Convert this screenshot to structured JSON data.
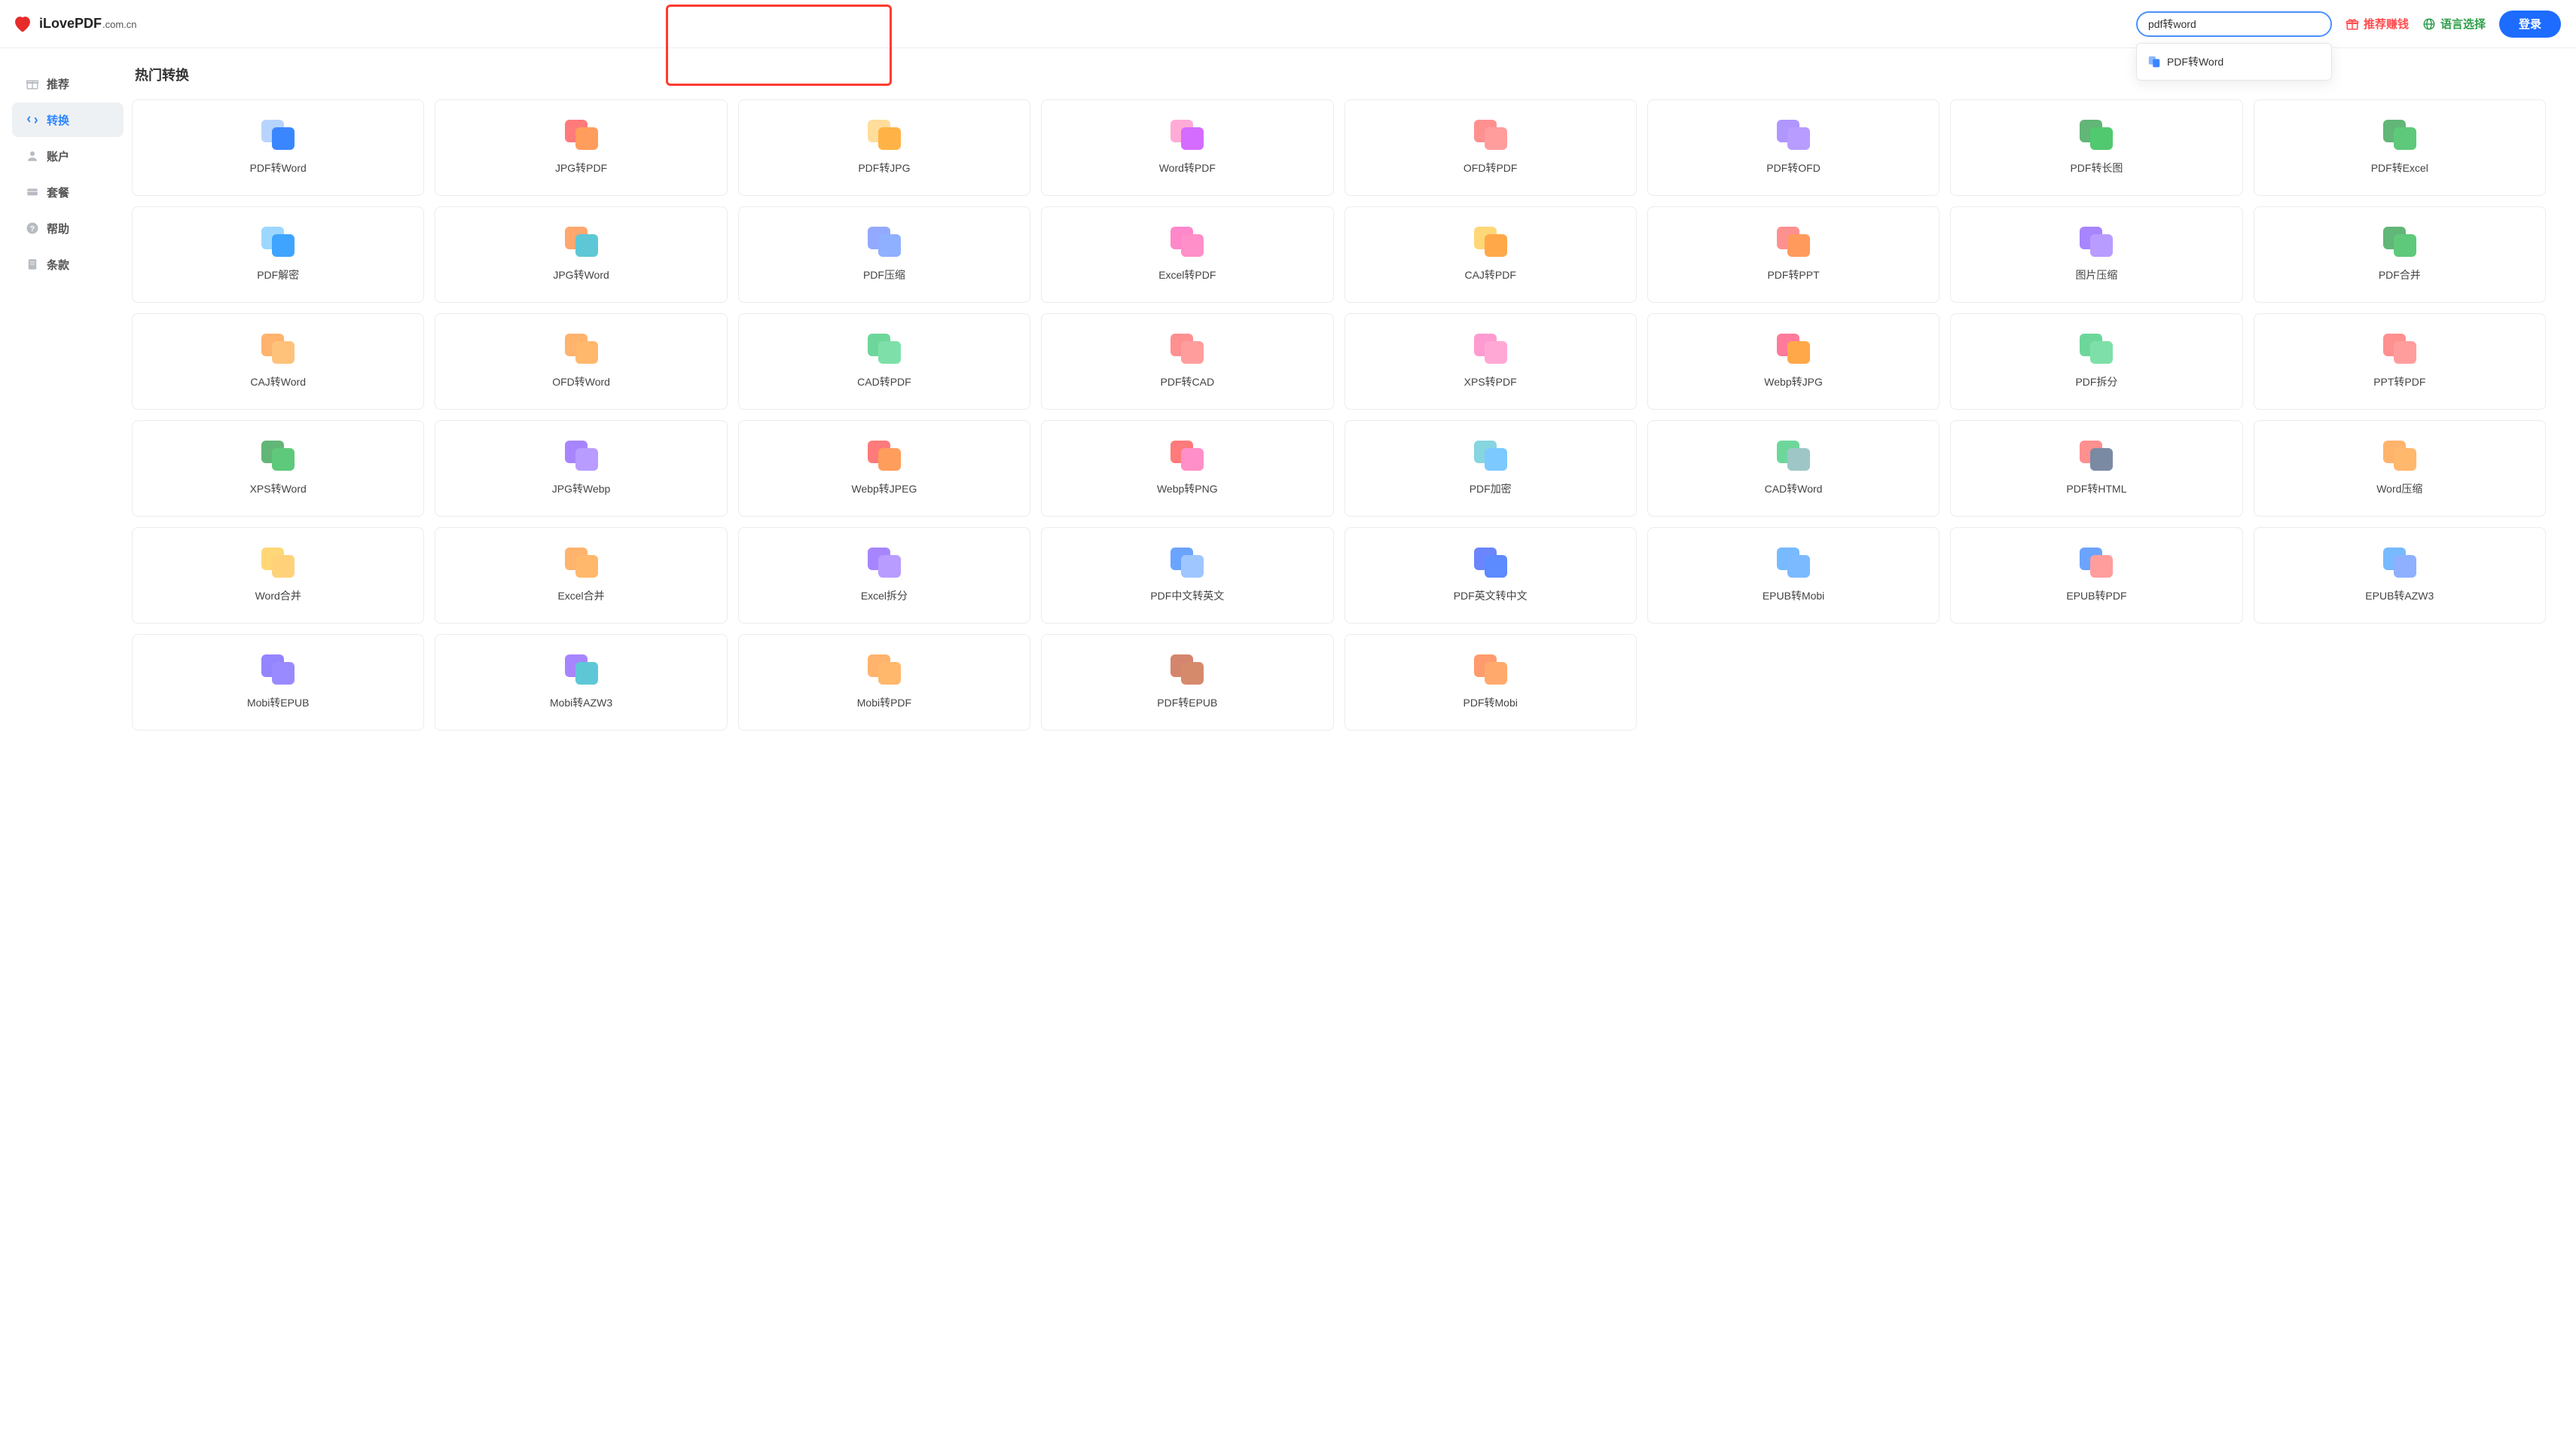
{
  "brand": {
    "name": "iLovePDF",
    "suffix": ".com.cn"
  },
  "search": {
    "value": "pdf转word",
    "dropdown_item": "PDF转Word"
  },
  "nav": {
    "referral": "推荐赚钱",
    "language": "语言选择",
    "login": "登录"
  },
  "sidebar": {
    "items": [
      {
        "label": "推荐",
        "icon": "gift"
      },
      {
        "label": "转换",
        "icon": "swap",
        "active": true
      },
      {
        "label": "账户",
        "icon": "user"
      },
      {
        "label": "套餐",
        "icon": "card"
      },
      {
        "label": "帮助",
        "icon": "help"
      },
      {
        "label": "条款",
        "icon": "doc"
      }
    ]
  },
  "page_title": "热门转换",
  "tools": [
    {
      "label": "PDF转Word",
      "c1": "#9fc6ff",
      "c2": "#3a86ff"
    },
    {
      "label": "JPG转PDF",
      "c1": "#ff4d4d",
      "c2": "#ff9d5c"
    },
    {
      "label": "PDF转JPG",
      "c1": "#ffd27a",
      "c2": "#ffb347"
    },
    {
      "label": "Word转PDF",
      "c1": "#ff8fc8",
      "c2": "#d46cff"
    },
    {
      "label": "OFD转PDF",
      "c1": "#ff6b6b",
      "c2": "#ff9d9d"
    },
    {
      "label": "PDF转OFD",
      "c1": "#9673ff",
      "c2": "#b89cff"
    },
    {
      "label": "PDF转长图",
      "c1": "#2e9e4a",
      "c2": "#51c96e"
    },
    {
      "label": "PDF转Excel",
      "c1": "#2e9e4a",
      "c2": "#5ec97a"
    },
    {
      "label": "PDF解密",
      "c1": "#7bc9ff",
      "c2": "#3fa4ff"
    },
    {
      "label": "JPG转Word",
      "c1": "#ff8a3c",
      "c2": "#5ec7d6"
    },
    {
      "label": "PDF压缩",
      "c1": "#6f8cff",
      "c2": "#8eb0ff"
    },
    {
      "label": "Excel转PDF",
      "c1": "#ff5fb8",
      "c2": "#ff8fc8"
    },
    {
      "label": "CAJ转PDF",
      "c1": "#ffc94a",
      "c2": "#ffa84a"
    },
    {
      "label": "PDF转PPT",
      "c1": "#ff6b6b",
      "c2": "#ff9a5c"
    },
    {
      "label": "图片压缩",
      "c1": "#8a5cff",
      "c2": "#b89cff"
    },
    {
      "label": "PDF合并",
      "c1": "#2e9e4a",
      "c2": "#5ec97a"
    },
    {
      "label": "CAJ转Word",
      "c1": "#ff9a3c",
      "c2": "#ffc27a"
    },
    {
      "label": "OFD转Word",
      "c1": "#ff9a3c",
      "c2": "#ffb86c"
    },
    {
      "label": "CAD转PDF",
      "c1": "#3cc97a",
      "c2": "#7ee0a8"
    },
    {
      "label": "PDF转CAD",
      "c1": "#ff6b6b",
      "c2": "#ff9d9d"
    },
    {
      "label": "XPS转PDF",
      "c1": "#ff7ac1",
      "c2": "#ffa8d5"
    },
    {
      "label": "Webp转JPG",
      "c1": "#ff4d7a",
      "c2": "#ffa84a"
    },
    {
      "label": "PDF拆分",
      "c1": "#3cc97a",
      "c2": "#7ee0a8"
    },
    {
      "label": "PPT转PDF",
      "c1": "#ff6b6b",
      "c2": "#ff9d9d"
    },
    {
      "label": "XPS转Word",
      "c1": "#2e9e4a",
      "c2": "#5ec97a"
    },
    {
      "label": "JPG转Webp",
      "c1": "#8a5cff",
      "c2": "#b89cff"
    },
    {
      "label": "Webp转JPEG",
      "c1": "#ff4d4d",
      "c2": "#ff9d5c"
    },
    {
      "label": "Webp转PNG",
      "c1": "#ff4d4d",
      "c2": "#ff8fc8"
    },
    {
      "label": "PDF加密",
      "c1": "#5ec7d6",
      "c2": "#7bc9ff"
    },
    {
      "label": "CAD转Word",
      "c1": "#3cc97a",
      "c2": "#9fc6c6"
    },
    {
      "label": "PDF转HTML",
      "c1": "#ff6b6b",
      "c2": "#7a8aa3"
    },
    {
      "label": "Word压缩",
      "c1": "#ff9a3c",
      "c2": "#ffb86c"
    },
    {
      "label": "Word合并",
      "c1": "#ffc94a",
      "c2": "#ffd27a"
    },
    {
      "label": "Excel合并",
      "c1": "#ff9a3c",
      "c2": "#ffb86c"
    },
    {
      "label": "Excel拆分",
      "c1": "#8a5cff",
      "c2": "#b89cff"
    },
    {
      "label": "PDF中文转英文",
      "c1": "#3a86ff",
      "c2": "#9fc6ff"
    },
    {
      "label": "PDF英文转中文",
      "c1": "#3a5cff",
      "c2": "#5c8aff"
    },
    {
      "label": "EPUB转Mobi",
      "c1": "#4aa3ff",
      "c2": "#7bbaff"
    },
    {
      "label": "EPUB转PDF",
      "c1": "#3a86ff",
      "c2": "#ff9d9d"
    },
    {
      "label": "EPUB转AZW3",
      "c1": "#4aa3ff",
      "c2": "#8eb0ff"
    },
    {
      "label": "Mobi转EPUB",
      "c1": "#6f5cff",
      "c2": "#9a8aff"
    },
    {
      "label": "Mobi转AZW3",
      "c1": "#8a5cff",
      "c2": "#5ec7d6"
    },
    {
      "label": "Mobi转PDF",
      "c1": "#ff9a3c",
      "c2": "#ffb86c"
    },
    {
      "label": "PDF转EPUB",
      "c1": "#c55c3c",
      "c2": "#d68a6c"
    },
    {
      "label": "PDF转Mobi",
      "c1": "#ff7a3c",
      "c2": "#ffaa6c"
    }
  ]
}
